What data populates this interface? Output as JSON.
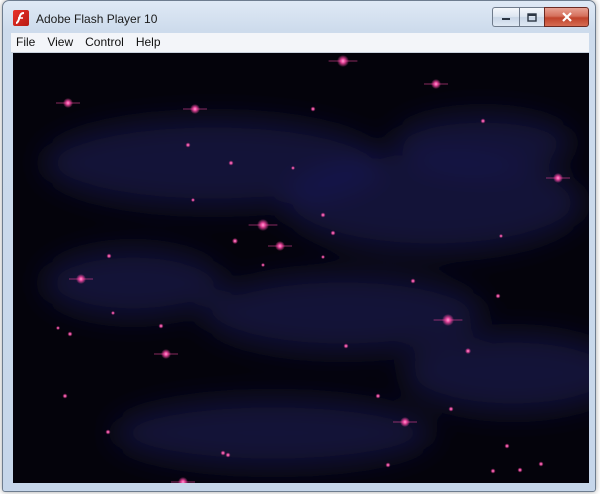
{
  "window": {
    "title": "Adobe Flash Player 10"
  },
  "menu": {
    "items": [
      "File",
      "View",
      "Control",
      "Help"
    ]
  },
  "stage": {
    "background": "#04030b",
    "nebula_color": "#1c1d5c",
    "star_color": "#ff4aa8"
  }
}
